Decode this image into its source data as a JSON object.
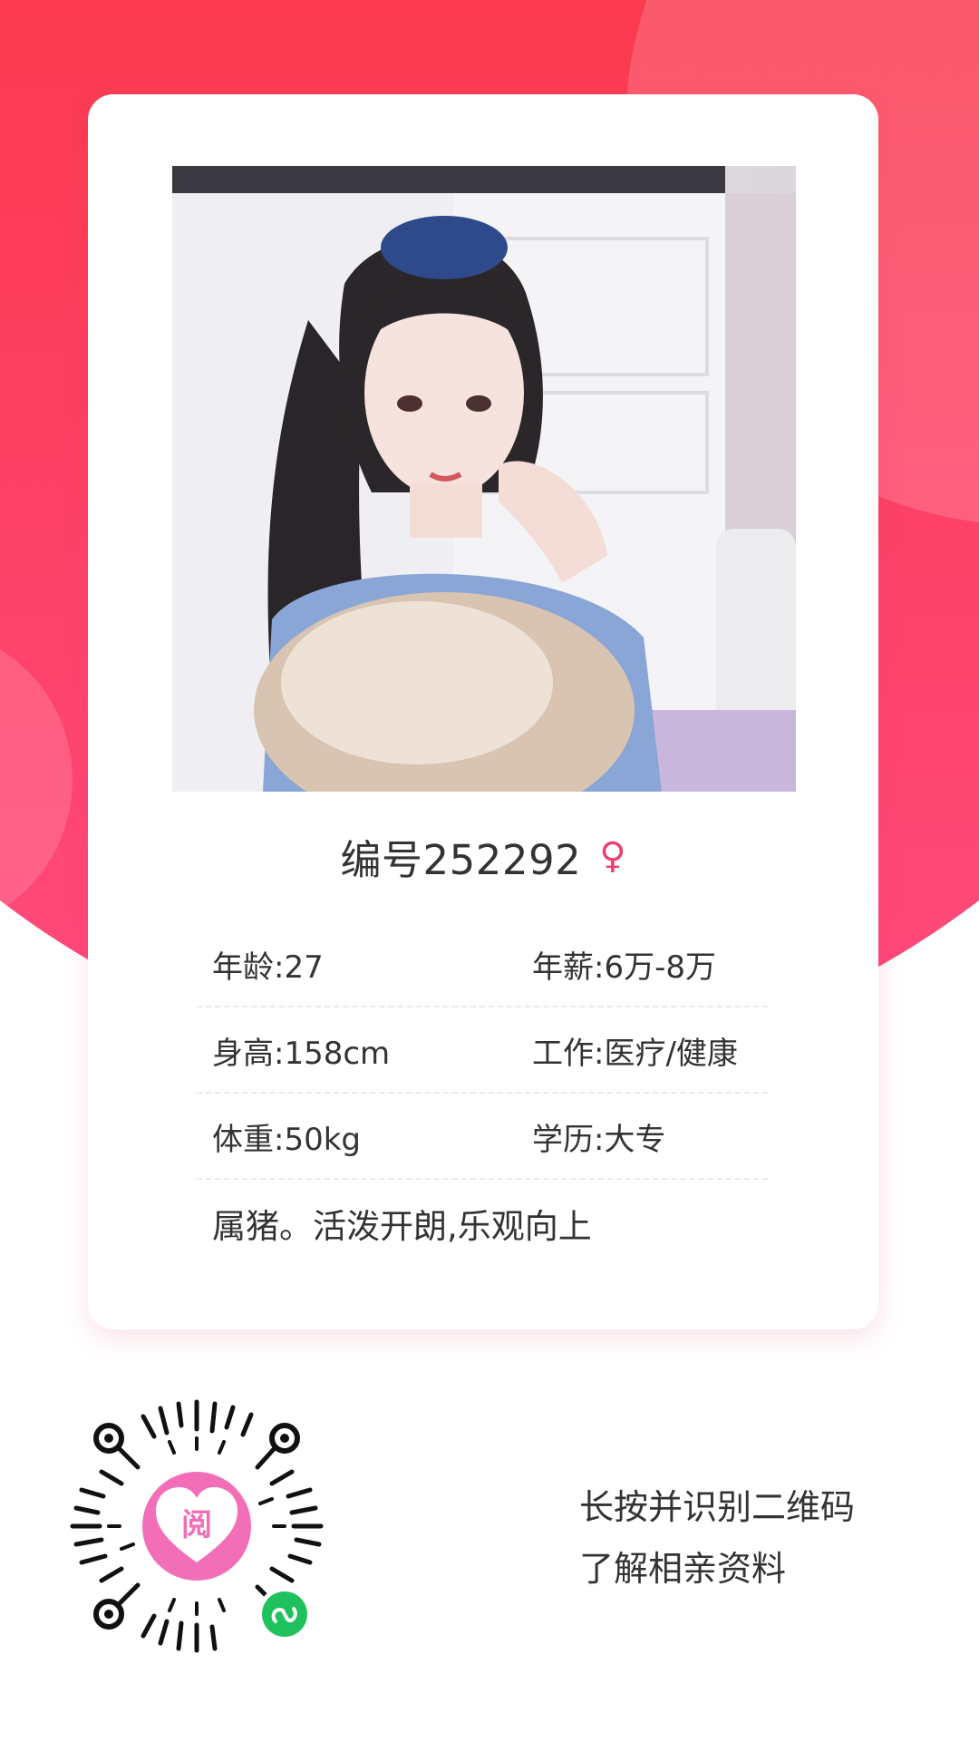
{
  "profile": {
    "id_label": "编号252292",
    "gender_symbol": "♀",
    "age": "年龄:27",
    "salary": "年薪:6万-8万",
    "height": "身高:158cm",
    "job": "工作:医疗/健康",
    "weight": "体重:50kg",
    "education": "学历:大专",
    "intro": "属猪。活泼开朗,乐观向上"
  },
  "qr": {
    "logo_char": "阅",
    "icon": "mini-program-code-icon"
  },
  "hint": {
    "line1": "长按并识别二维码",
    "line2": "了解相亲资料"
  },
  "colors": {
    "bg_red": "#f7312f",
    "bg_pink": "#ff4a7e",
    "accent_pink": "#ec3f70",
    "logo_pink": "#f26fb7",
    "mini_program_green": "#1fc15d"
  }
}
